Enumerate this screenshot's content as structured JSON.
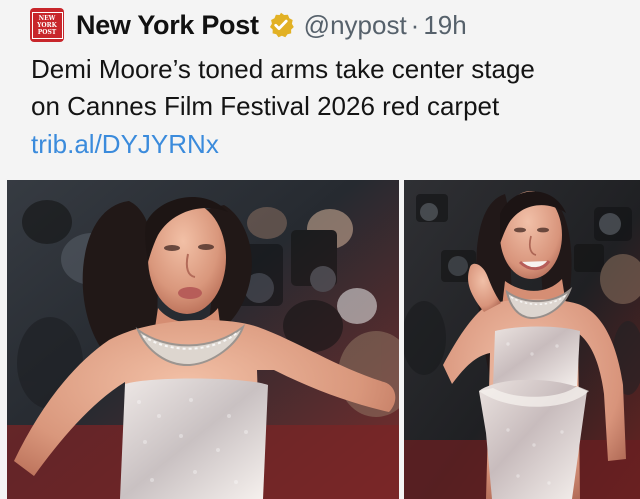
{
  "post": {
    "author": {
      "avatar_text": [
        "NEW",
        "YORK",
        "POST"
      ],
      "display_name": "New York Post",
      "handle": "@nypost",
      "separator": "·",
      "time": "19h",
      "verified_icon": "gold-verified-badge-icon",
      "brand_color": "#c8262b"
    },
    "text_lines": [
      "Demi Moore’s toned arms take center stage",
      "on Cannes Film Festival 2026 red carpet"
    ],
    "link_text": "trib.al/DYJYRNx",
    "media": {
      "images": [
        {
          "name": "red-carpet-photo-1"
        },
        {
          "name": "red-carpet-photo-2"
        }
      ]
    },
    "colors": {
      "background": "#f4f4f4",
      "text": "#141414",
      "secondary_text": "#56616b",
      "link": "#3b8bdc"
    }
  }
}
